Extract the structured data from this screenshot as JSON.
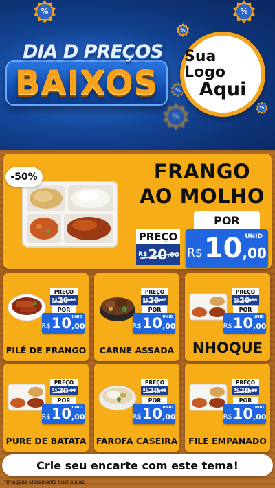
{
  "header": {
    "title_line1": "DIA D PREÇOS",
    "title_line2": "BAIXOS",
    "percent_symbol": "%",
    "logo_line1": "Sua Logo",
    "logo_line2": "Aqui",
    "colors": {
      "background": "#154a9e",
      "accent": "#f3a51f"
    }
  },
  "featured": {
    "discount": "-50%",
    "name_line1": "FRANGO",
    "name_line2": "AO MOLHO",
    "preco_label": "PREÇO",
    "old_price": {
      "currency": "R$",
      "integer": "20",
      "cents": ",00"
    },
    "por_label": "POR",
    "new_price": {
      "currency": "R$",
      "integer": "10",
      "cents": ",00",
      "unit": "UNID"
    },
    "image_icon": "food-tray-icon"
  },
  "products": [
    {
      "name": "FILÉ DE FRANGO",
      "preco_label": "PREÇO",
      "old_currency": "R$",
      "old_integer": "20",
      "old_cents": ",00",
      "por_label": "POR",
      "currency": "R$",
      "integer": "10",
      "cents": ",00",
      "unit": "UNID",
      "image_icon": "steak-bowl-icon"
    },
    {
      "name": "CARNE ASSADA",
      "preco_label": "PREÇO",
      "old_currency": "R$",
      "old_integer": "20",
      "old_cents": ",00",
      "por_label": "POR",
      "currency": "R$",
      "integer": "10",
      "cents": ",00",
      "unit": "UNID",
      "image_icon": "roast-bowl-icon"
    },
    {
      "name": "NHOQUE",
      "preco_label": "PREÇO",
      "old_currency": "R$",
      "old_integer": "20",
      "old_cents": ",00",
      "por_label": "POR",
      "currency": "R$",
      "integer": "10",
      "cents": ",00",
      "unit": "UNID",
      "image_icon": "food-tray-icon"
    },
    {
      "name": "PURE DE BATATA",
      "preco_label": "PREÇO",
      "old_currency": "R$",
      "old_integer": "20",
      "old_cents": ",00",
      "por_label": "POR",
      "currency": "R$",
      "integer": "10",
      "cents": ",00",
      "unit": "UNID",
      "image_icon": "food-tray-icon"
    },
    {
      "name": "FAROFA CASEIRA",
      "preco_label": "PREÇO",
      "old_currency": "R$",
      "old_integer": "20",
      "old_cents": ",00",
      "por_label": "POR",
      "currency": "R$",
      "integer": "10",
      "cents": ",00",
      "unit": "UNID",
      "image_icon": "rice-bowl-icon"
    },
    {
      "name": "FILE EMPANADO",
      "preco_label": "PREÇO",
      "old_currency": "R$",
      "old_integer": "20",
      "old_cents": ",00",
      "por_label": "POR",
      "currency": "R$",
      "integer": "10",
      "cents": ",00",
      "unit": "UNID",
      "image_icon": "food-tray-icon"
    }
  ],
  "footer": {
    "cta": "Crie seu encarte com este tema!",
    "disclaimer": "*Imagens Meramente Ilustrativas"
  },
  "colors": {
    "card": "#f6ad18",
    "price_blue": "#1f66e0",
    "old_price_blue": "#1b3f93",
    "wood": "#a75f1d"
  }
}
